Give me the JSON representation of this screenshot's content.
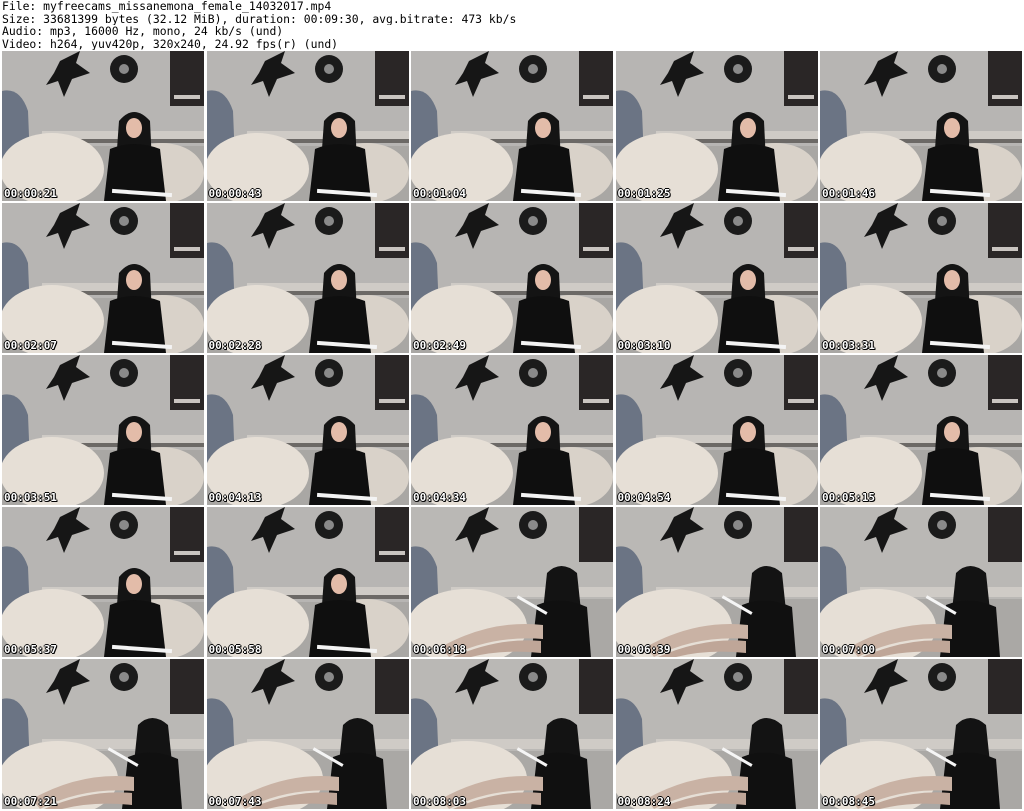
{
  "header": {
    "file_line": "File: myfreecams_missanemona_female_14032017.mp4",
    "size_line": "Size: 33681399 bytes (32.12 MiB), duration: 00:09:30, avg.bitrate: 473 kb/s",
    "audio_line": "Audio: mp3, 16000 Hz, mono, 24 kb/s (und)",
    "video_line": "Video: h264, yuv420p, 320x240, 24.92 fps(r) (und)"
  },
  "thumbnails": [
    {
      "timestamp": "00:00:21",
      "scene": "seated"
    },
    {
      "timestamp": "00:00:43",
      "scene": "seated"
    },
    {
      "timestamp": "00:01:04",
      "scene": "seated"
    },
    {
      "timestamp": "00:01:25",
      "scene": "seated"
    },
    {
      "timestamp": "00:01:46",
      "scene": "seated"
    },
    {
      "timestamp": "00:02:07",
      "scene": "seated"
    },
    {
      "timestamp": "00:02:28",
      "scene": "seated"
    },
    {
      "timestamp": "00:02:49",
      "scene": "seated"
    },
    {
      "timestamp": "00:03:10",
      "scene": "seated"
    },
    {
      "timestamp": "00:03:31",
      "scene": "seated"
    },
    {
      "timestamp": "00:03:51",
      "scene": "seated"
    },
    {
      "timestamp": "00:04:13",
      "scene": "seated"
    },
    {
      "timestamp": "00:04:34",
      "scene": "seated"
    },
    {
      "timestamp": "00:04:54",
      "scene": "seated"
    },
    {
      "timestamp": "00:05:15",
      "scene": "seated"
    },
    {
      "timestamp": "00:05:37",
      "scene": "seated"
    },
    {
      "timestamp": "00:05:58",
      "scene": "seated"
    },
    {
      "timestamp": "00:06:18",
      "scene": "reclined"
    },
    {
      "timestamp": "00:06:39",
      "scene": "reclined"
    },
    {
      "timestamp": "00:07:00",
      "scene": "reclined"
    },
    {
      "timestamp": "00:07:21",
      "scene": "reclined"
    },
    {
      "timestamp": "00:07:43",
      "scene": "reclined"
    },
    {
      "timestamp": "00:08:03",
      "scene": "reclined"
    },
    {
      "timestamp": "00:08:24",
      "scene": "reclined"
    },
    {
      "timestamp": "00:08:45",
      "scene": "reclined"
    }
  ]
}
